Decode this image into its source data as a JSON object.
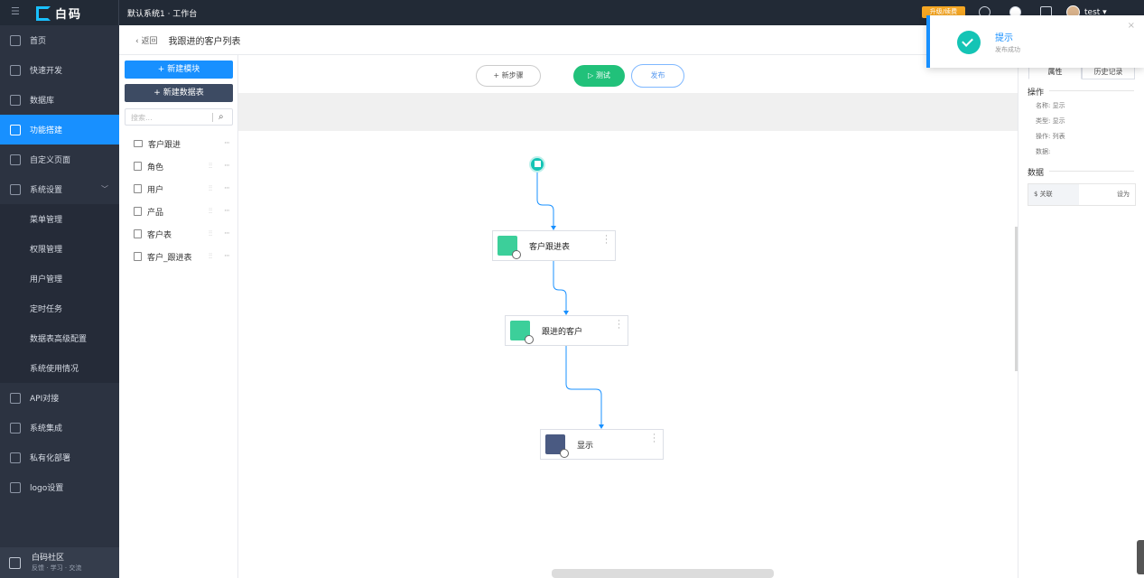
{
  "app": {
    "brand": "白码",
    "window_title": "默认系统1 · 工作台",
    "upgrade_badge": "升级/续费",
    "user": "test ▾"
  },
  "sidebar": {
    "items": [
      {
        "label": "首页",
        "active": false
      },
      {
        "label": "快速开发",
        "active": false
      },
      {
        "label": "数据库",
        "active": false
      },
      {
        "label": "功能搭建",
        "active": true
      },
      {
        "label": "自定义页面",
        "active": false
      },
      {
        "label": "系统设置",
        "active": false
      },
      {
        "label": "菜单管理",
        "active": false
      },
      {
        "label": "权限管理",
        "active": false
      },
      {
        "label": "用户管理",
        "active": false
      },
      {
        "label": "定时任务",
        "active": false
      },
      {
        "label": "数据表高级配置",
        "active": false
      },
      {
        "label": "系统使用情况",
        "active": false
      },
      {
        "label": "API对接",
        "active": false
      },
      {
        "label": "系统集成",
        "active": false
      },
      {
        "label": "私有化部署",
        "active": false
      },
      {
        "label": "logo设置",
        "active": false
      }
    ],
    "footer": {
      "title": "白码社区",
      "subtitle": "反馈 · 学习 · 交流"
    }
  },
  "breadcrumb": {
    "back": "‹ 返回",
    "title": "我跟进的客户列表"
  },
  "tree": {
    "new_module": "+ 新建模块",
    "new_table": "+ 新建数据表",
    "search_placeholder": "搜索...",
    "items": [
      {
        "label": "客户跟进",
        "type": "folder"
      },
      {
        "label": "角色",
        "type": "table"
      },
      {
        "label": "用户",
        "type": "table"
      },
      {
        "label": "产品",
        "type": "table"
      },
      {
        "label": "客户表",
        "type": "table"
      },
      {
        "label": "客户_跟进表",
        "type": "table"
      }
    ]
  },
  "canvas": {
    "add_step": "+ 新步骤",
    "test": "▷ 测试",
    "publish": "发布",
    "nodes": [
      {
        "label": "客户跟进表",
        "icon": "table-query-icon"
      },
      {
        "label": "跟进的客户",
        "icon": "table-link-icon"
      },
      {
        "label": "显示",
        "icon": "display-list-icon"
      }
    ]
  },
  "panel": {
    "tabs": [
      "属性",
      "历史记录"
    ],
    "op_section": "操作",
    "props": [
      "名称: 显示",
      "类型: 显示",
      "操作: 列表",
      "数据:"
    ],
    "data_section": "数据",
    "relation_key": "$ 关联",
    "relation_value": "设为"
  },
  "toast": {
    "title": "提示",
    "message": "发布成功",
    "close": "×"
  },
  "colors": {
    "accent": "#1890ff",
    "success": "#21c17a",
    "sidebar": "#2c3341",
    "topbar": "#222a36"
  }
}
